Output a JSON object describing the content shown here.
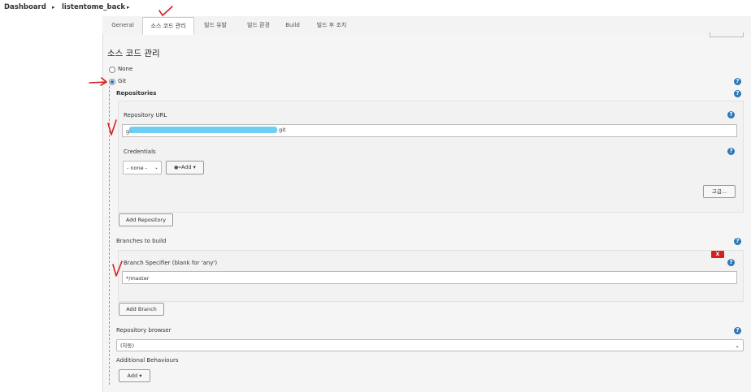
{
  "breadcrumb": {
    "dashboard": "Dashboard",
    "project": "listentome_back"
  },
  "tabs": [
    {
      "label": "General"
    },
    {
      "label": "소스 코드 관리"
    },
    {
      "label": "빌드 유발"
    },
    {
      "label": "빌드 환경"
    },
    {
      "label": "Build"
    },
    {
      "label": "빌드 후 조치"
    }
  ],
  "scm": {
    "title": "소스 코드 관리",
    "none_label": "None",
    "git_label": "Git",
    "selected": "Git",
    "repositories_label": "Repositories",
    "repo_url_label": "Repository URL",
    "repo_url_prefix": "git",
    "repo_url_suffix": ".git",
    "credentials_label": "Credentials",
    "credentials_value": "- none -",
    "add_label": "Add",
    "advanced_label": "고급...",
    "add_repository_label": "Add Repository",
    "branches_label": "Branches to build",
    "delete_label": "X",
    "branch_specifier_label": "Branch Specifier (blank for 'any')",
    "branch_specifier_value": "*/master",
    "add_branch_label": "Add Branch",
    "repo_browser_label": "Repository browser",
    "repo_browser_value": "(자동)",
    "additional_behaviours_label": "Additional Behaviours",
    "add_behaviour_label": "Add"
  },
  "icons": {
    "help": "help-icon",
    "dropdown": "chevron-down-icon",
    "key": "key-icon"
  },
  "colors": {
    "help": "#2c78b8",
    "delete": "#d62020",
    "annotation": "#d62020",
    "redaction": "#5ec9f2"
  }
}
